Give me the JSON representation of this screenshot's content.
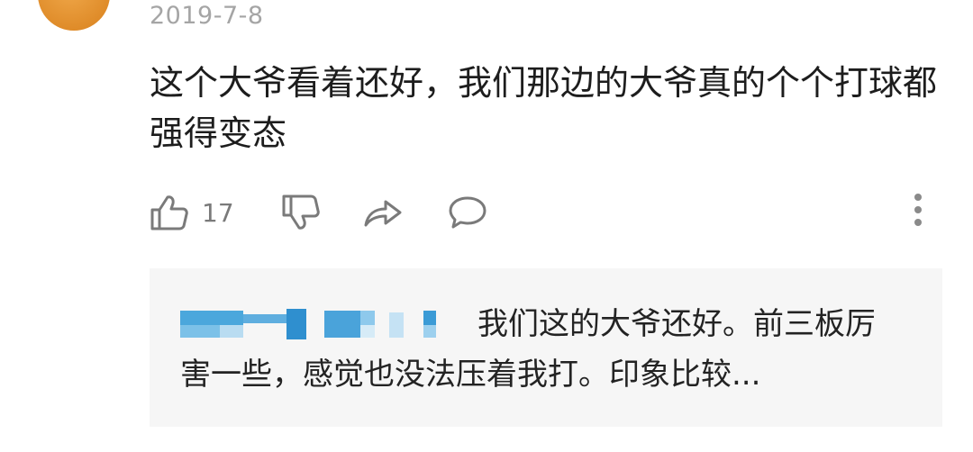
{
  "comment": {
    "date": "2019-7-8",
    "text": "这个大爷看着还好，我们那边的大爷真的个个打球都强得变态"
  },
  "actions": {
    "like_count": "17"
  },
  "reply": {
    "text": "我们这的大爷还好。前三板厉害一些，感觉也没法压着我打。印象比较..."
  },
  "colors": {
    "avatar": "#e0922e",
    "date": "#a5a5a5",
    "reply_background": "#f6f6f6",
    "mosaic": "#3b9bd6"
  }
}
